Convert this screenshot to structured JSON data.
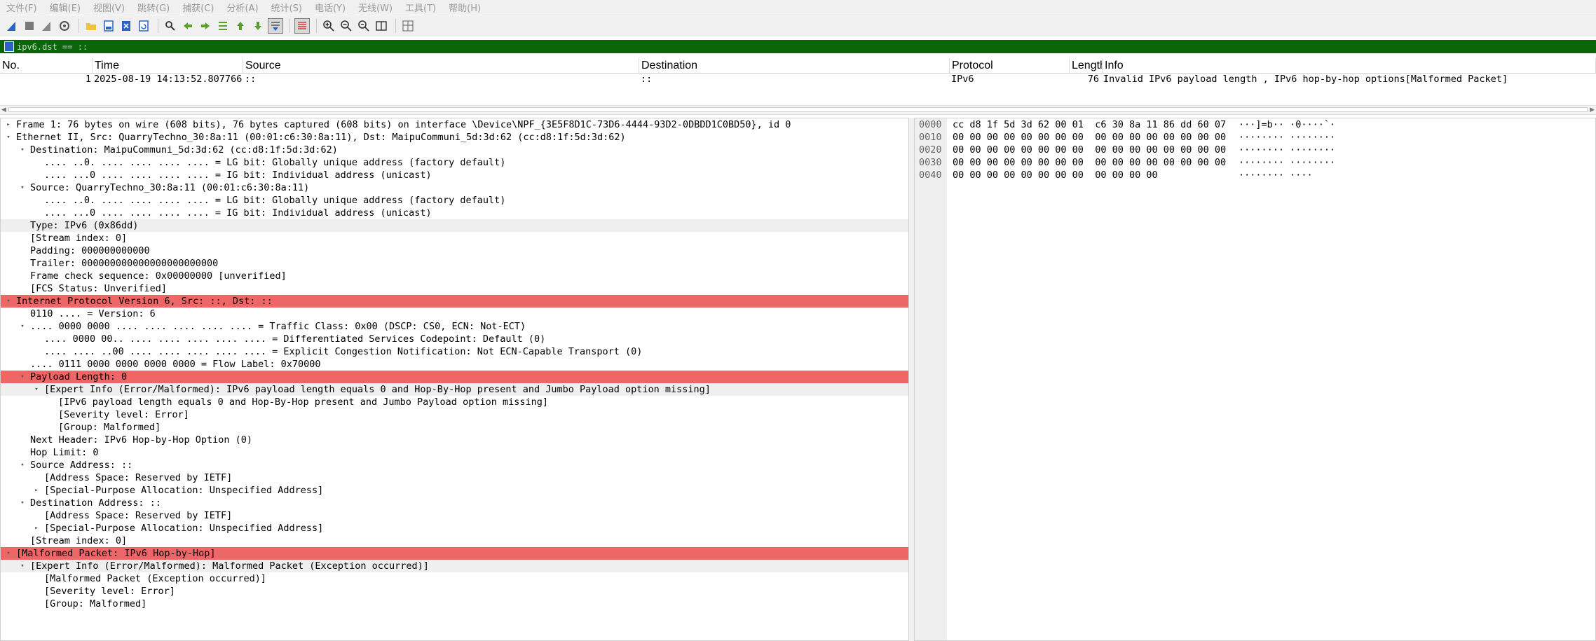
{
  "menu": [
    "文件(F)",
    "编辑(E)",
    "视图(V)",
    "跳转(G)",
    "捕获(C)",
    "分析(A)",
    "统计(S)",
    "电话(Y)",
    "无线(W)",
    "工具(T)",
    "帮助(H)"
  ],
  "toolbar_icons": [
    "shark-fin-start-icon",
    "stop-capture-icon",
    "restart-capture-icon",
    "capture-options-icon",
    "open-file-icon",
    "save-file-icon",
    "close-file-icon",
    "reload-file-icon",
    "find-packet-icon",
    "go-back-icon",
    "go-forward-icon",
    "go-to-packet-icon",
    "first-packet-icon",
    "last-packet-icon",
    "auto-scroll-icon",
    "colorize-icon",
    "zoom-in-icon",
    "zoom-out-icon",
    "normal-size-icon",
    "resize-columns-icon",
    "layout-icon"
  ],
  "filter": {
    "value": "ipv6.dst == ::",
    "color": "#0b6608"
  },
  "packet_list": {
    "columns": [
      "No.",
      "Time",
      "Source",
      "Destination",
      "Protocol",
      "Length",
      "Info"
    ],
    "rows": [
      {
        "no": "1",
        "time": "2025-08-19 14:13:52.807766",
        "source": "::",
        "destination": "::",
        "protocol": "IPv6",
        "length": "76",
        "info": "Invalid IPv6 payload length , IPv6 hop-by-hop options[Malformed Packet]"
      }
    ]
  },
  "tree": [
    {
      "level": 0,
      "expander": "collapsed",
      "style": "",
      "text": "Frame 1: 76 bytes on wire (608 bits), 76 bytes captured (608 bits) on interface \\Device\\NPF_{3E5F8D1C-73D6-4444-93D2-0DBDD1C0BD50}, id 0"
    },
    {
      "level": 0,
      "expander": "expanded",
      "style": "",
      "text": "Ethernet II, Src: QuarryTechno_30:8a:11 (00:01:c6:30:8a:11), Dst: MaipuCommuni_5d:3d:62 (cc:d8:1f:5d:3d:62)"
    },
    {
      "level": 1,
      "expander": "expanded",
      "style": "",
      "text": "Destination: MaipuCommuni_5d:3d:62 (cc:d8:1f:5d:3d:62)"
    },
    {
      "level": 2,
      "expander": "none",
      "style": "",
      "text": ".... ..0. .... .... .... .... = LG bit: Globally unique address (factory default)"
    },
    {
      "level": 2,
      "expander": "none",
      "style": "",
      "text": ".... ...0 .... .... .... .... = IG bit: Individual address (unicast)"
    },
    {
      "level": 1,
      "expander": "expanded",
      "style": "",
      "text": "Source: QuarryTechno_30:8a:11 (00:01:c6:30:8a:11)"
    },
    {
      "level": 2,
      "expander": "none",
      "style": "",
      "text": ".... ..0. .... .... .... .... = LG bit: Globally unique address (factory default)"
    },
    {
      "level": 2,
      "expander": "none",
      "style": "",
      "text": ".... ...0 .... .... .... .... = IG bit: Individual address (unicast)"
    },
    {
      "level": 1,
      "expander": "none",
      "style": "shaded",
      "text": "Type: IPv6 (0x86dd)"
    },
    {
      "level": 1,
      "expander": "none",
      "style": "",
      "text": "[Stream index: 0]"
    },
    {
      "level": 1,
      "expander": "none",
      "style": "",
      "text": "Padding: 000000000000"
    },
    {
      "level": 1,
      "expander": "none",
      "style": "",
      "text": "Trailer: 000000000000000000000000"
    },
    {
      "level": 1,
      "expander": "none",
      "style": "",
      "text": "Frame check sequence: 0x00000000 [unverified]"
    },
    {
      "level": 1,
      "expander": "none",
      "style": "",
      "text": "[FCS Status: Unverified]"
    },
    {
      "level": 0,
      "expander": "expanded",
      "style": "err",
      "text": "Internet Protocol Version 6, Src: ::, Dst: ::"
    },
    {
      "level": 1,
      "expander": "none",
      "style": "",
      "text": "0110 .... = Version: 6"
    },
    {
      "level": 1,
      "expander": "expanded",
      "style": "",
      "text": ".... 0000 0000 .... .... .... .... .... = Traffic Class: 0x00 (DSCP: CS0, ECN: Not-ECT)"
    },
    {
      "level": 2,
      "expander": "none",
      "style": "",
      "text": ".... 0000 00.. .... .... .... .... .... = Differentiated Services Codepoint: Default (0)"
    },
    {
      "level": 2,
      "expander": "none",
      "style": "",
      "text": ".... .... ..00 .... .... .... .... .... = Explicit Congestion Notification: Not ECN-Capable Transport (0)"
    },
    {
      "level": 1,
      "expander": "none",
      "style": "",
      "text": ".... 0111 0000 0000 0000 0000 = Flow Label: 0x70000"
    },
    {
      "level": 1,
      "expander": "expanded",
      "style": "err",
      "text": "Payload Length: 0"
    },
    {
      "level": 2,
      "expander": "expanded",
      "style": "shaded",
      "text": "[Expert Info (Error/Malformed): IPv6 payload length equals 0 and Hop-By-Hop present and Jumbo Payload option missing]"
    },
    {
      "level": 3,
      "expander": "none",
      "style": "",
      "text": "[IPv6 payload length equals 0 and Hop-By-Hop present and Jumbo Payload option missing]"
    },
    {
      "level": 3,
      "expander": "none",
      "style": "",
      "text": "[Severity level: Error]"
    },
    {
      "level": 3,
      "expander": "none",
      "style": "",
      "text": "[Group: Malformed]"
    },
    {
      "level": 1,
      "expander": "none",
      "style": "",
      "text": "Next Header: IPv6 Hop-by-Hop Option (0)"
    },
    {
      "level": 1,
      "expander": "none",
      "style": "",
      "text": "Hop Limit: 0"
    },
    {
      "level": 1,
      "expander": "expanded",
      "style": "",
      "text": "Source Address: ::"
    },
    {
      "level": 2,
      "expander": "none",
      "style": "",
      "text": "[Address Space: Reserved by IETF]"
    },
    {
      "level": 2,
      "expander": "collapsed",
      "style": "",
      "text": "[Special-Purpose Allocation: Unspecified Address]"
    },
    {
      "level": 1,
      "expander": "expanded",
      "style": "",
      "text": "Destination Address: ::"
    },
    {
      "level": 2,
      "expander": "none",
      "style": "",
      "text": "[Address Space: Reserved by IETF]"
    },
    {
      "level": 2,
      "expander": "collapsed",
      "style": "",
      "text": "[Special-Purpose Allocation: Unspecified Address]"
    },
    {
      "level": 1,
      "expander": "none",
      "style": "",
      "text": "[Stream index: 0]"
    },
    {
      "level": 0,
      "expander": "expanded",
      "style": "err",
      "text": "[Malformed Packet: IPv6 Hop-by-Hop]"
    },
    {
      "level": 1,
      "expander": "expanded",
      "style": "shaded",
      "text": "[Expert Info (Error/Malformed): Malformed Packet (Exception occurred)]"
    },
    {
      "level": 2,
      "expander": "none",
      "style": "",
      "text": "[Malformed Packet (Exception occurred)]"
    },
    {
      "level": 2,
      "expander": "none",
      "style": "",
      "text": "[Severity level: Error]"
    },
    {
      "level": 2,
      "expander": "none",
      "style": "",
      "text": "[Group: Malformed]"
    }
  ],
  "hex": [
    {
      "offset": "0000",
      "bytes": "cc d8 1f 5d 3d 62 00 01  c6 30 8a 11 86 dd 60 07",
      "ascii": "···]=b·· ·0····`·"
    },
    {
      "offset": "0010",
      "bytes": "00 00 00 00 00 00 00 00  00 00 00 00 00 00 00 00",
      "ascii": "········ ········"
    },
    {
      "offset": "0020",
      "bytes": "00 00 00 00 00 00 00 00  00 00 00 00 00 00 00 00",
      "ascii": "········ ········"
    },
    {
      "offset": "0030",
      "bytes": "00 00 00 00 00 00 00 00  00 00 00 00 00 00 00 00",
      "ascii": "········ ········"
    },
    {
      "offset": "0040",
      "bytes": "00 00 00 00 00 00 00 00  00 00 00 00",
      "ascii": "········ ····"
    }
  ],
  "colors": {
    "error_row": "#ee6666",
    "shaded_row": "#efefef",
    "filter_ok": "#0b6608"
  }
}
